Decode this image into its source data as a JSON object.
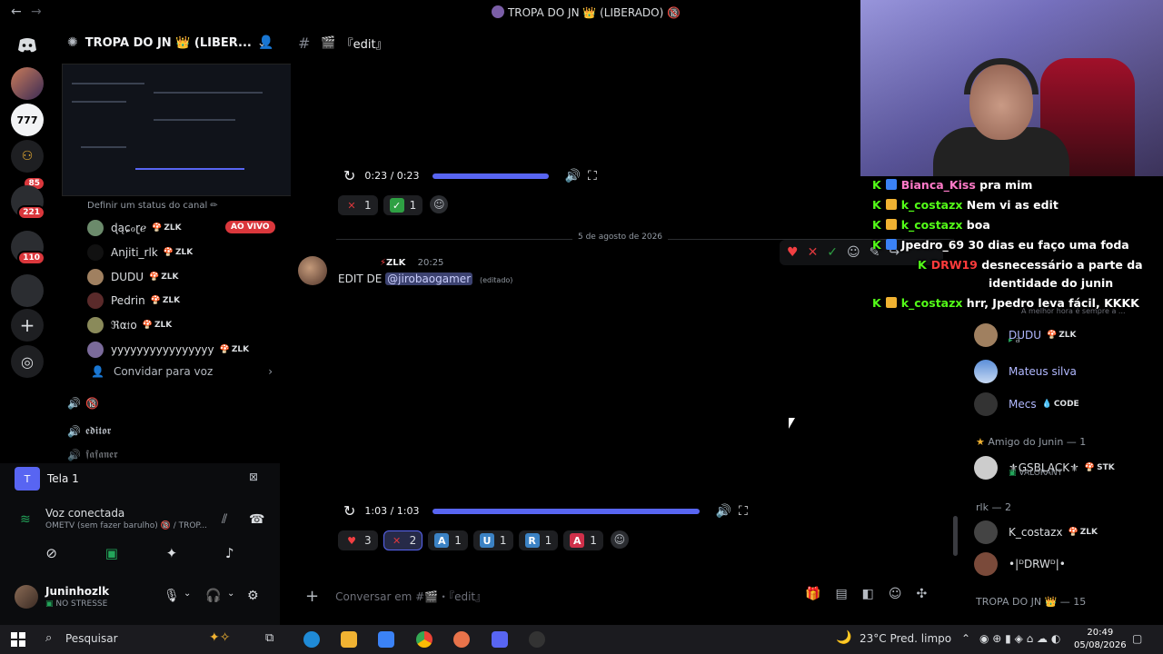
{
  "titlebar": {
    "title": "TROPA DO JN 👑 (LIBERADO) 🔞",
    "back_icon": "←",
    "forward_icon": "→"
  },
  "rail": {
    "badges": [
      "85",
      "221",
      "110"
    ]
  },
  "sidebar": {
    "server_name": "TROPA DO JN 👑 (LIBER...",
    "status_prompt": "Definir um status do canal ✏",
    "live_label": "AO VIVO",
    "voice_users": [
      {
        "name": "ɖąɕℴɽℯ",
        "tag": "ZLK"
      },
      {
        "name": "Anjiti_rlk",
        "tag": "ZLK"
      },
      {
        "name": "DUDU",
        "tag": "ZLK"
      },
      {
        "name": "Pedrin",
        "tag": "ZLK"
      },
      {
        "name": "ℜα𝔱ο",
        "tag": "ZLK"
      },
      {
        "name": "yyyyyyyyyyyyyyyy",
        "tag": "ZLK"
      }
    ],
    "invite_label": "Convidar para voz",
    "channels": [
      "🔞",
      "𝖊𝖉𝖎𝖙𝖔𝖗",
      "𝖋𝖆𝖋𝖆𝖓𝖊𝖗"
    ]
  },
  "voice_panel": {
    "screen_label": "Tela 1",
    "status": "Voz conectada",
    "channel": "OMETV (sem fazer barulho) 🔞 / TROP..."
  },
  "user_panel": {
    "name": "Juninhozlk",
    "status": "NO STRESSE"
  },
  "chat": {
    "channel_name": "『edit』",
    "video1": {
      "time": "0:23 / 0:23",
      "progress": 1.0
    },
    "reactions1": [
      {
        "emoji": "✕",
        "count": "1",
        "color": "#da373c",
        "me": false
      },
      {
        "emoji": "✓",
        "count": "1",
        "color": "#2ea043",
        "me": false
      }
    ],
    "date_divider": "5 de agosto de 2026",
    "message": {
      "tag": "ZLK",
      "time": "20:25",
      "prefix": "EDIT DE",
      "mention": "@jirobaogamer",
      "edited": "(editado)"
    },
    "video2": {
      "time": "1:03 / 1:03",
      "progress": 1.0
    },
    "reactions2": [
      {
        "emoji": "♥",
        "count": "3",
        "color": "#f23f42",
        "me": false
      },
      {
        "emoji": "✕",
        "count": "2",
        "color": "#da373c",
        "me": true
      },
      {
        "emoji": "A",
        "count": "1",
        "color": "#3b82c4",
        "me": false
      },
      {
        "emoji": "U",
        "count": "1",
        "color": "#3b82c4",
        "me": false
      },
      {
        "emoji": "R",
        "count": "1",
        "color": "#3b82c4",
        "me": false
      },
      {
        "emoji": "A",
        "count": "1",
        "color": "#d0304a",
        "me": false
      }
    ],
    "composer_placeholder": "Conversar em #🎬・『edit』"
  },
  "overlay_chat": [
    {
      "user": "Bianca_Kiss",
      "color": "#ff7ac8",
      "text": "pra mim"
    },
    {
      "user": "k_costazx",
      "color": "#53fc18",
      "text": "Nem vi as edit"
    },
    {
      "user": "k_costazx",
      "color": "#53fc18",
      "text": "boa"
    },
    {
      "user": "Jpedro_69",
      "color": "#ffffff",
      "text": "30 dias eu faço uma foda"
    },
    {
      "user": "DRW19",
      "color": "#ff3b3b",
      "text": "desnecessário a parte da"
    },
    {
      "user": "",
      "color": "#ffffff",
      "text": "identidade do junin"
    },
    {
      "user": "k_costazx",
      "color": "#53fc18",
      "text": "hrr, Jpedro leva fácil, KKKK"
    }
  ],
  "members": {
    "items": [
      {
        "name": "DUDU",
        "tag": "ZLK",
        "sub": "a"
      },
      {
        "name": "Mateus silva"
      },
      {
        "name": "Mecs",
        "tag": "CODE"
      }
    ],
    "group_amigo": "Amigo do Junin — 1",
    "amigo_member": {
      "name": "⚜GSBLACK⚜",
      "tag": "STK",
      "sub": "VALORANT"
    },
    "group_rlk": "rlk — 2",
    "rlk_members": [
      {
        "name": "K_costazx",
        "tag": "ZLK"
      },
      {
        "name": "•|ᴰDRWᴰ|•"
      }
    ],
    "group_tropa": "TROPA DO JN 👑 — 15",
    "partial_sub": "A melhor hora é sempre a ..."
  },
  "taskbar": {
    "search": "Pesquisar",
    "weather": "23°C  Pred. limpo",
    "time": "20:49",
    "date": "05/08/2026"
  }
}
